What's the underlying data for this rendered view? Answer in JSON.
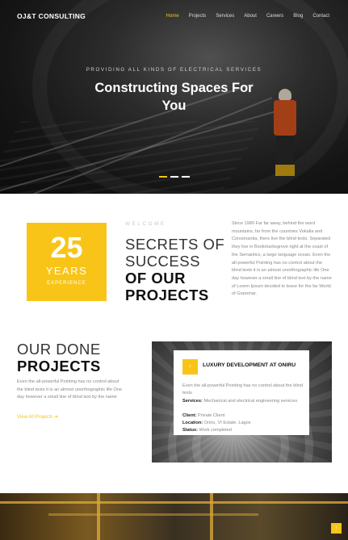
{
  "header": {
    "brand": "OJ&T CONSULTING",
    "menu": [
      "Home",
      "Projects",
      "Services",
      "About",
      "Careers",
      "Blog",
      "Contact"
    ],
    "active_index": 0
  },
  "hero": {
    "subtitle": "PROVIDING ALL KINDS OF ELECTRICAL SERVICES",
    "title_line1": "Constructing Spaces For",
    "title_line2": "You",
    "slides_count": 3,
    "active_slide": 0
  },
  "about": {
    "years_number": "25",
    "years_label": "YEARS",
    "experience_label": "EXPERIENCE",
    "welcome": "WELCOME",
    "heading_light_1": "SECRETS OF",
    "heading_light_2": "SUCCESS",
    "heading_bold_1": "OF OUR",
    "heading_bold_2": "PROJECTS",
    "text": "Since 1980 Far far away, behind the word mountains, far from the countries Vokalia and Consonantia, there live the blind texts. Separated they live in Bookmarksgrove right at the coast of the Semantics, a large language ocean. Even the all-powerful Pointing has no control about the blind texts it is an almost unorthographic life One day however a small line of blind text by the name of Lorem Ipsum decided to leave for the far World of Grammar."
  },
  "projects": {
    "heading_light": "OUR DONE",
    "heading_bold": "PROJECTS",
    "text": "Even the all-powerful Pointing has no control about the blind texts it is an almost unorthographic life One day however a small line of blind text by the name",
    "view_all": "View All Projects ➔",
    "card": {
      "badge_icon": "arrow-up-icon",
      "badge_glyph": "↑",
      "title": "LUXURY DEVELOPMENT AT ONIRU",
      "description": "Even the all-powerful Pointing has no control about the blind texts",
      "services_label": "Services:",
      "services_value": "Mechanical and electrical engineering services",
      "client_label": "Client:",
      "client_value": "Private Client",
      "location_label": "Location:",
      "location_value": "Oniru, VI Estate, Lagos",
      "status_label": "Status:",
      "status_value": "Work completed"
    }
  },
  "scroll_top": {
    "icon": "arrow-up-icon",
    "glyph": "↑"
  },
  "colors": {
    "accent": "#f8c417",
    "dark_text": "#111111",
    "muted_text": "#888888"
  }
}
